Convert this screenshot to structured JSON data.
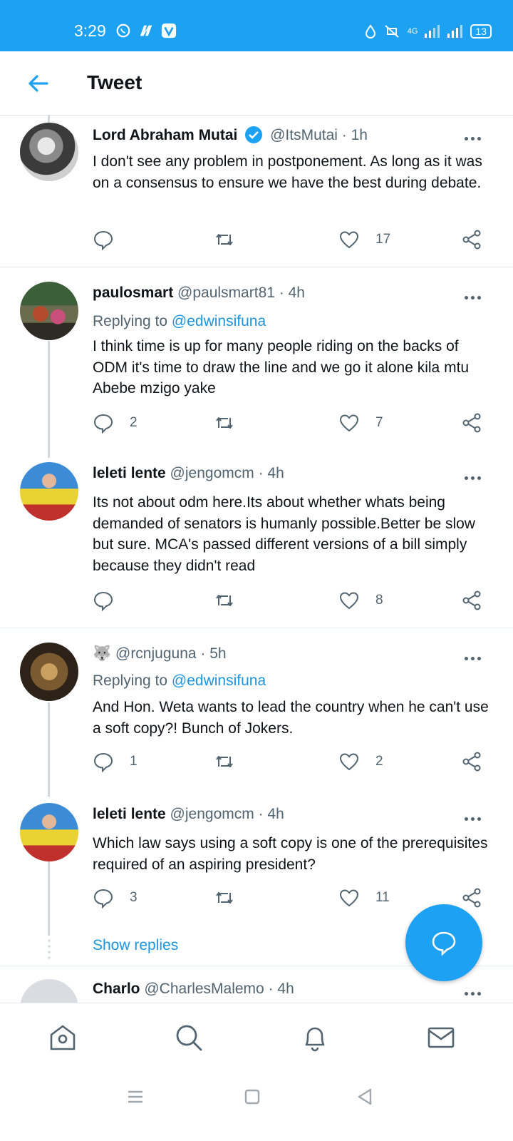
{
  "status_bar": {
    "time": "3:29",
    "battery": "13",
    "network": "4G"
  },
  "header": {
    "title": "Tweet"
  },
  "tweets": [
    {
      "name": "Lord Abraham Mutai",
      "handle": "@ItsMutai",
      "time": "· 1h",
      "verified": true,
      "replying_label": "",
      "replying_to": "",
      "body": "I don't see any problem in postponement. As long as it was on a consensus to ensure we have the best during debate.",
      "replies": "",
      "likes": "17"
    },
    {
      "name": "paulosmart",
      "handle": "@paulsmart81",
      "time": "· 4h",
      "replying_label": "Replying to",
      "replying_to": "@edwinsifuna",
      "body": "I think time is up for many people riding on the backs of ODM it's time to draw the line and we go it alone kila mtu Abebe mzigo yake",
      "replies": "2",
      "likes": "7"
    },
    {
      "name": "leleti lente",
      "handle": "@jengomcm",
      "time": "· 4h",
      "replying_label": "",
      "replying_to": "",
      "body": "Its not about odm here.Its about whether whats being demanded of senators is humanly possible.Better be slow but sure. MCA's passed different versions of a bill simply because they didn't read",
      "replies": "",
      "likes": "8"
    },
    {
      "name": "🐺",
      "handle": "@rcnjuguna",
      "time": "· 5h",
      "replying_label": "Replying to",
      "replying_to": "@edwinsifuna",
      "body": "And Hon. Weta wants to lead the country when he can't use a soft copy?! Bunch of Jokers.",
      "replies": "1",
      "likes": "2"
    },
    {
      "name": "leleti lente",
      "handle": "@jengomcm",
      "time": "· 4h",
      "replying_label": "",
      "replying_to": "",
      "body": "Which law says using a soft copy is one of the prerequisites required of an aspiring president?",
      "replies": "3",
      "likes": "11"
    },
    {
      "name": "Charlo",
      "handle": "@CharlesMalemo",
      "time": "· 4h"
    }
  ],
  "show_replies": "Show replies",
  "icons": {
    "reply": "reply-icon",
    "retweet": "retweet-icon",
    "like": "heart-icon",
    "share": "share-icon",
    "home": "home-icon",
    "search": "search-icon",
    "notifications": "bell-icon",
    "messages": "mail-icon",
    "compose": "compose-reply-icon"
  },
  "colors": {
    "brand": "#1da1f2",
    "link": "#1b95e0",
    "muted": "#536471"
  }
}
